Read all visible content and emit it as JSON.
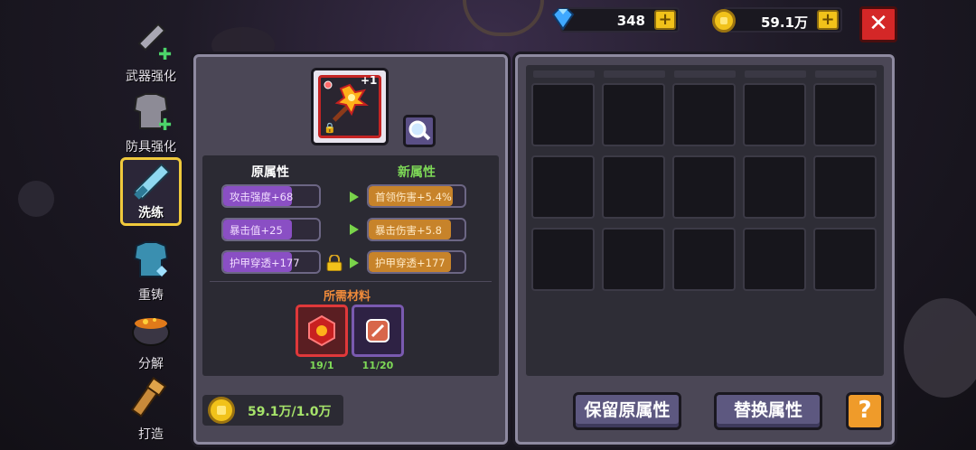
{
  "resources": {
    "gems": "348",
    "gold": "59.1万"
  },
  "sidebar": [
    {
      "label": "武器强化",
      "icon": "sword-upgrade-icon"
    },
    {
      "label": "防具强化",
      "icon": "armor-upgrade-icon"
    },
    {
      "label": "洗练",
      "icon": "refine-sword-icon",
      "active": true
    },
    {
      "label": "重铸",
      "icon": "reforge-armor-icon"
    },
    {
      "label": "分解",
      "icon": "cauldron-icon"
    },
    {
      "label": "打造",
      "icon": "forge-hammer-icon"
    }
  ],
  "item": {
    "level": "+1",
    "icon": "fire-staff-icon"
  },
  "attributes": {
    "old_title": "原属性",
    "new_title": "新属性",
    "old": [
      {
        "text": "攻击强度+68",
        "fill": 0.72
      },
      {
        "text": "暴击值+25",
        "fill": 0.72
      },
      {
        "text": "护甲穿透+177",
        "fill": 0.72
      }
    ],
    "new": [
      {
        "text": "首领伤害+5.4%",
        "fill": 0.88
      },
      {
        "text": "暴击伤害+5.8",
        "fill": 0.86
      },
      {
        "text": "护甲穿透+177",
        "fill": 0.86
      }
    ]
  },
  "materials": {
    "title": "所需材料",
    "items": [
      {
        "icon": "red-gem-material-icon",
        "count": "19/1"
      },
      {
        "icon": "reroll-stone-material-icon",
        "count": "11/20"
      }
    ]
  },
  "cost": "59.1万/1.0万",
  "buttons": {
    "keep": "保留原属性",
    "replace": "替换属性",
    "help": "?"
  },
  "colors": {
    "gem": "#3fa8ff",
    "gold": "#f1c21a",
    "old_attr_fill": "#8a4fc4",
    "new_attr_fill": "#c7832a",
    "green": "#7ed957",
    "close": "#d42727"
  }
}
